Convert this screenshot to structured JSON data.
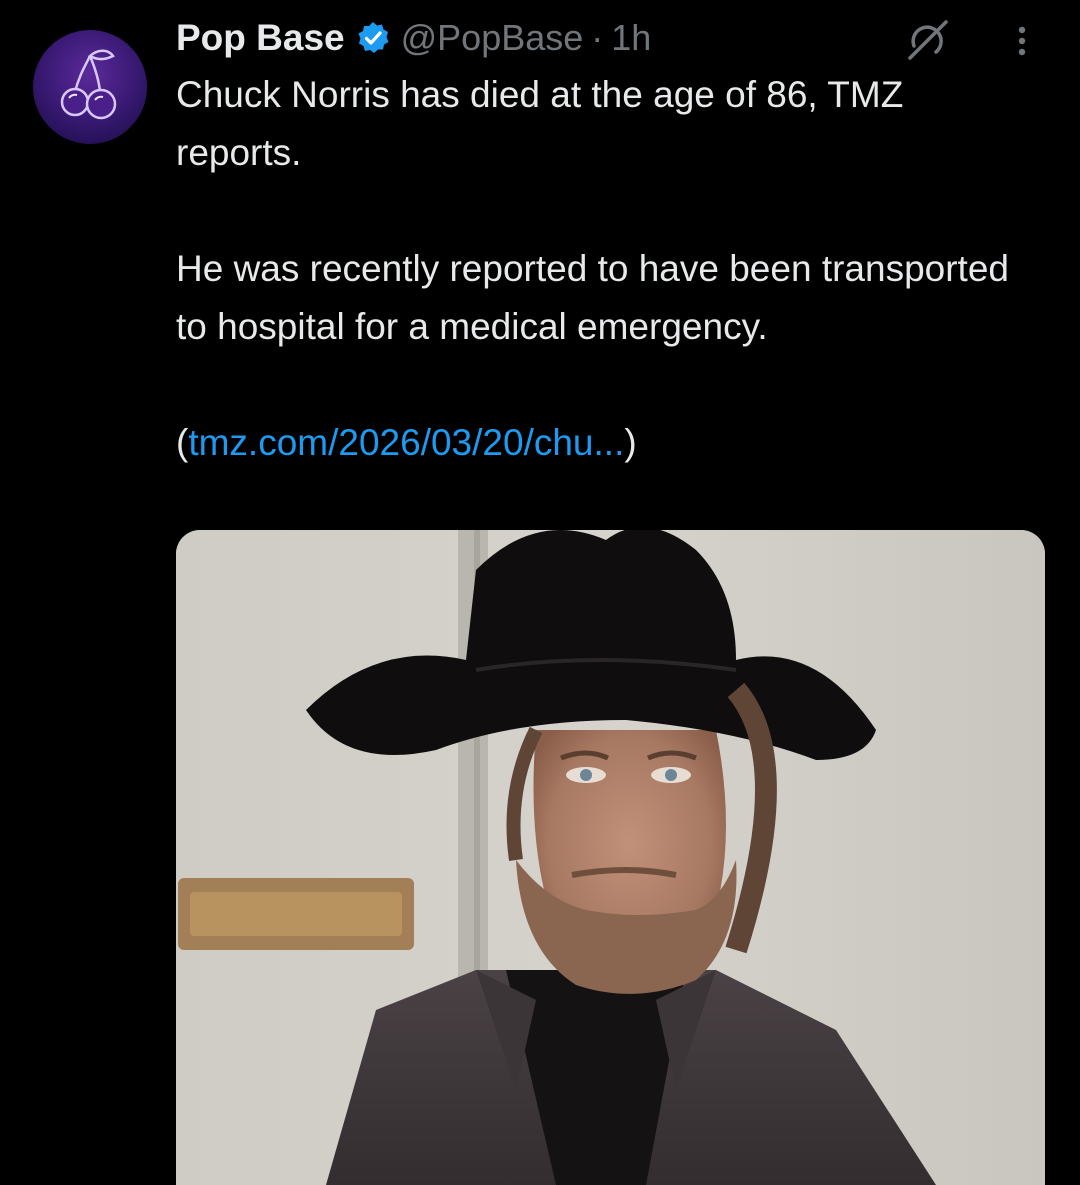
{
  "tweet": {
    "display_name": "Pop Base",
    "handle": "@PopBase",
    "separator": "·",
    "time": "1h",
    "text_line1": "Chuck Norris has died at the age of 86, TMZ reports.",
    "text_line2": "He was recently reported to have been transported to hospital for a medical emergency.",
    "link_open": "(",
    "link_text": "tmz.com/2026/03/20/chu...",
    "link_close": ")"
  },
  "icons": {
    "avatar": "cherries-logo",
    "verified": "verified-badge-icon",
    "grok": "grok-icon",
    "more": "more-vertical-icon"
  },
  "colors": {
    "background": "#000000",
    "text": "#e7e9ea",
    "muted": "#71767b",
    "link": "#1d9bf0",
    "verified": "#1d9bf0"
  }
}
